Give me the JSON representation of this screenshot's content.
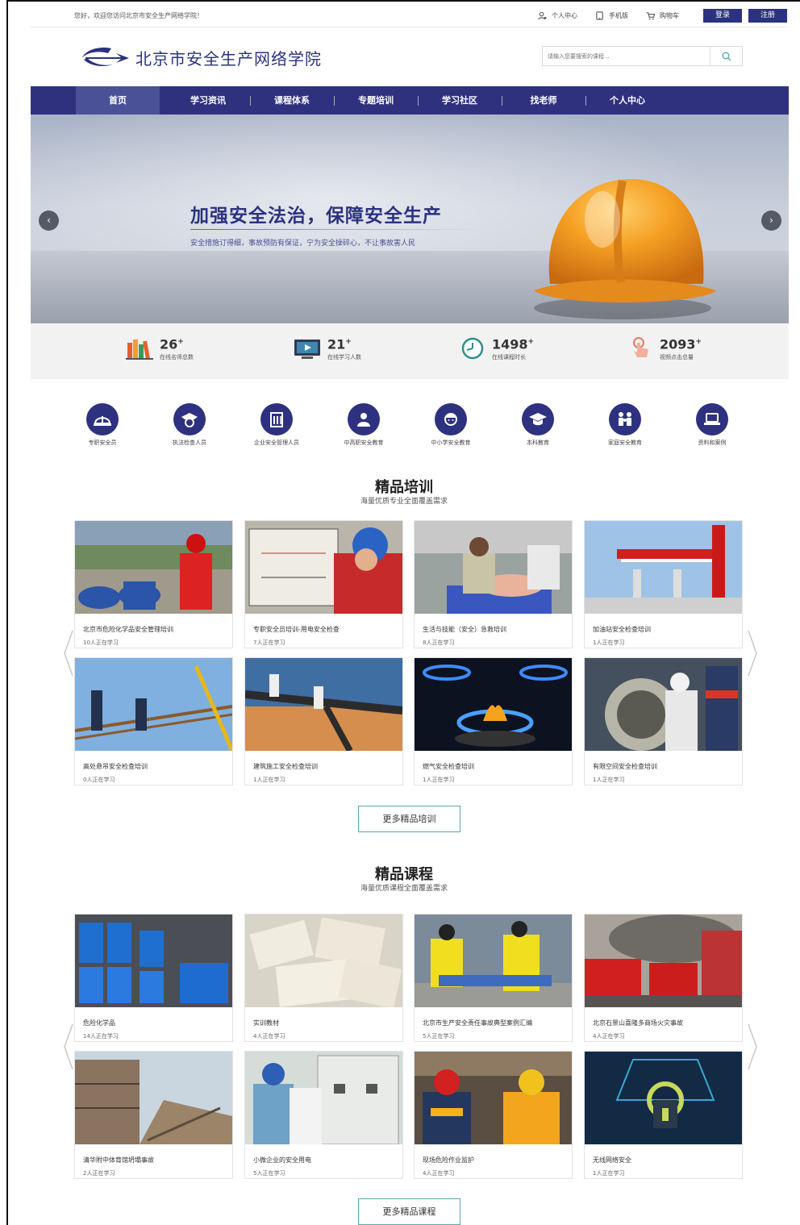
{
  "topbar": {
    "welcome": "您好，欢迎您访问北京市安全生产网络学院！",
    "links": [
      {
        "label": "个人中心",
        "icon": "user-icon"
      },
      {
        "label": "手机版",
        "icon": "mobile-icon"
      },
      {
        "label": "购物车",
        "icon": "cart-icon"
      }
    ],
    "login": "登录",
    "register": "注册"
  },
  "header": {
    "logo_text": "北京市安全生产网络学院",
    "search_placeholder": "请输入您要搜索的课程..."
  },
  "nav": {
    "items": [
      "首页",
      "学习资讯",
      "课程体系",
      "专题培训",
      "学习社区",
      "找老师",
      "个人中心"
    ],
    "active": "首页"
  },
  "banner": {
    "title": "加强安全法治，保障安全生产",
    "subtitle": "安全措施订得细，事故预防有保证，宁为安全操碎心，不让事故害人民"
  },
  "stats": [
    {
      "value": "26",
      "suffix": "+",
      "label": "在线名师总数",
      "icon": "books-icon"
    },
    {
      "value": "21",
      "suffix": "+",
      "label": "在线学习人数",
      "icon": "video-icon"
    },
    {
      "value": "1498",
      "suffix": "+",
      "label": "在线课程时长",
      "icon": "clock-icon"
    },
    {
      "value": "2093",
      "suffix": "+",
      "label": "视频点击总量",
      "icon": "pointer-icon"
    }
  ],
  "categories": [
    {
      "label": "专职安全员",
      "icon": "hardhat-icon"
    },
    {
      "label": "执法检查人员",
      "icon": "police-cap-icon"
    },
    {
      "label": "企业安全管理人员",
      "icon": "building-icon"
    },
    {
      "label": "中高职安全教育",
      "icon": "student-icon"
    },
    {
      "label": "中小学安全教育",
      "icon": "child-icon"
    },
    {
      "label": "本科教育",
      "icon": "graduation-cap-icon"
    },
    {
      "label": "家庭安全教育",
      "icon": "family-icon"
    },
    {
      "label": "资料和案例",
      "icon": "laptop-icon"
    }
  ],
  "training": {
    "title": "精品培训",
    "subtitle": "海量优质专业全面覆盖需求",
    "more": "更多精品培训",
    "cards": [
      {
        "title": "北京市危险化学品安全管理培训",
        "count": "10人正在学习"
      },
      {
        "title": "专职安全员培训-用电安全检查",
        "count": "7人正在学习"
      },
      {
        "title": "生活与技能（安全）急救培训",
        "count": "8人正在学习"
      },
      {
        "title": "加油站安全检查培训",
        "count": "1人正在学习"
      },
      {
        "title": "高处悬吊安全检查培训",
        "count": "0人正在学习"
      },
      {
        "title": "建筑施工安全检查培训",
        "count": "1人正在学习"
      },
      {
        "title": "燃气安全检查培训",
        "count": "1人正在学习"
      },
      {
        "title": "有限空间安全检查培训",
        "count": "1人正在学习"
      }
    ]
  },
  "courses": {
    "title": "精品课程",
    "subtitle": "海量优质课程全面覆盖需求",
    "more": "更多精品课程",
    "cards": [
      {
        "title": "危险化学品",
        "count": "14人正在学习"
      },
      {
        "title": "实训教材",
        "count": "4人正在学习"
      },
      {
        "title": "北京市生产安全责任事故典型案例汇编",
        "count": "5人正在学习"
      },
      {
        "title": "北京石景山喜隆多商场火灾事故",
        "count": "4人正在学习"
      },
      {
        "title": "清华附中体育馆坍塌事故",
        "count": "2人正在学习"
      },
      {
        "title": "小微企业的安全用电",
        "count": "5人正在学习"
      },
      {
        "title": "现场危险作业监护",
        "count": "4人正在学习"
      },
      {
        "title": "无线网络安全",
        "count": "1人正在学习"
      }
    ]
  },
  "colors": {
    "brand": "#2f317e",
    "nav_active": "#4a5196",
    "button_border": "#5ba8a8"
  }
}
